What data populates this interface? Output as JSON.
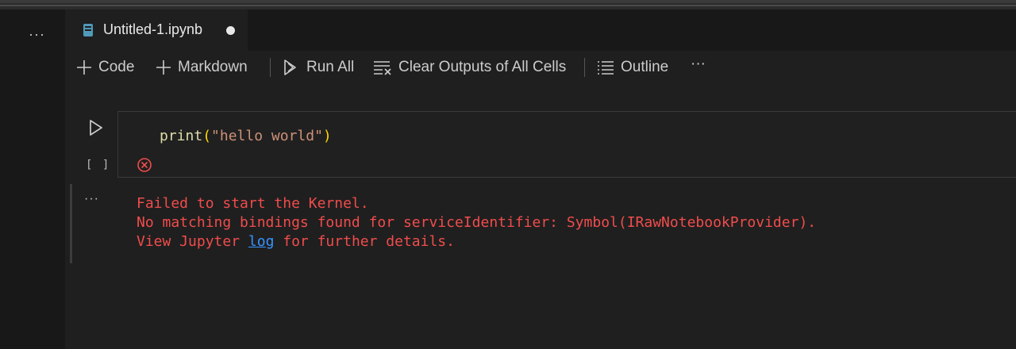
{
  "window": {
    "sidebar_more": "···"
  },
  "tab": {
    "title": "Untitled-1.ipynb"
  },
  "toolbar": {
    "code": "Code",
    "markdown": "Markdown",
    "run_all": "Run All",
    "clear_outputs": "Clear Outputs of All Cells",
    "outline": "Outline",
    "more": "···"
  },
  "cell": {
    "execution_count": "[ ]",
    "code": {
      "fn": "print",
      "open_paren": "(",
      "string": "\"hello world\"",
      "close_paren": ")"
    }
  },
  "output": {
    "more": "···",
    "line1": "Failed to start the Kernel.",
    "line2": "No matching bindings found for serviceIdentifier: Symbol(IRawNotebookProvider).",
    "line3_prefix": "View Jupyter ",
    "line3_link": "log",
    "line3_suffix": " for further details."
  },
  "colors": {
    "error": "#f14c4c",
    "link": "#3794ff",
    "background": "#1f1f1f"
  }
}
